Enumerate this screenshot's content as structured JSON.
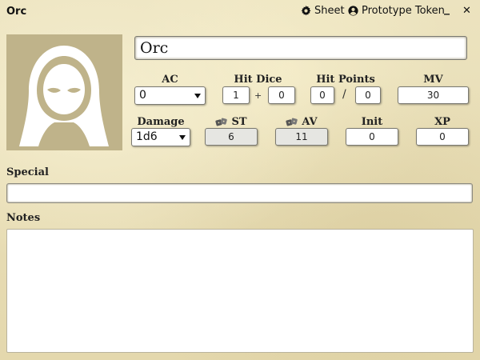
{
  "window": {
    "title": "Orc",
    "sheet_label": "Sheet",
    "token_label": "Prototype Token",
    "minimize_glyph": "_",
    "close_glyph": "✕"
  },
  "actor": {
    "name": "Orc"
  },
  "stats": {
    "ac": {
      "label": "AC",
      "value": "0"
    },
    "hit_dice": {
      "label": "Hit Dice",
      "count": "1",
      "plus": "+",
      "bonus": "0"
    },
    "hit_points": {
      "label": "Hit Points",
      "current": "0",
      "slash": "/",
      "max": "0"
    },
    "mv": {
      "label": "MV",
      "value": "30"
    },
    "damage": {
      "label": "Damage",
      "value": "1d6"
    },
    "st": {
      "label": "ST",
      "value": "6"
    },
    "av": {
      "label": "AV",
      "value": "11"
    },
    "init": {
      "label": "Init",
      "value": "0"
    },
    "xp": {
      "label": "XP",
      "value": "0"
    }
  },
  "special": {
    "label": "Special",
    "value": ""
  },
  "notes": {
    "label": "Notes",
    "value": ""
  },
  "icons": {
    "sheet": "gear-icon",
    "token": "user-circle-icon",
    "dice": "dice-icon",
    "portrait": "hooded-figure-icon"
  },
  "colors": {
    "parchment": "#e9dfb8",
    "portrait_bg": "#bfb38a",
    "field_grey": "#e6e6e2"
  }
}
